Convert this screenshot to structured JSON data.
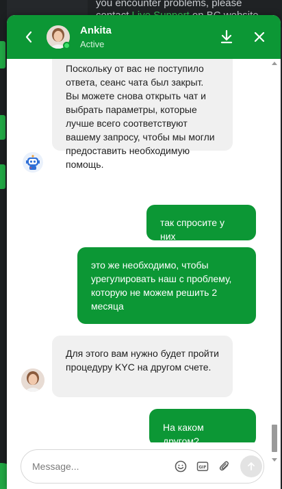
{
  "background": {
    "text_line1": "you encounter problems, please",
    "text_line2_pre": "contact ",
    "text_line2_link": "Live Support",
    "text_line2_post": " on BC website"
  },
  "header": {
    "agent_name": "Ankita",
    "agent_status": "Active",
    "accent_color": "#0c9735"
  },
  "messages": [
    {
      "from": "bot",
      "text": "Поскольку от вас не поступило ответа, сеанс чата был закрыт. Вы можете снова открыть чат и выбрать параметры, которые лучше всего соответствуют вашему запросу, чтобы мы могли предоставить необходимую помощь."
    },
    {
      "from": "user",
      "text": "так спросите у них"
    },
    {
      "from": "user",
      "text": "это же необходимо, чтобы урегулировать наш с проблему, которую не можем решить 2 месяца"
    },
    {
      "from": "agent",
      "text": "Для этого вам нужно будет пройти процедуру KYC на другом счете."
    },
    {
      "from": "user",
      "text": "На каком другом?"
    }
  ],
  "composer": {
    "placeholder": "Message...",
    "icons": [
      "emoji-icon",
      "gif-icon",
      "attach-icon",
      "send-icon"
    ]
  }
}
